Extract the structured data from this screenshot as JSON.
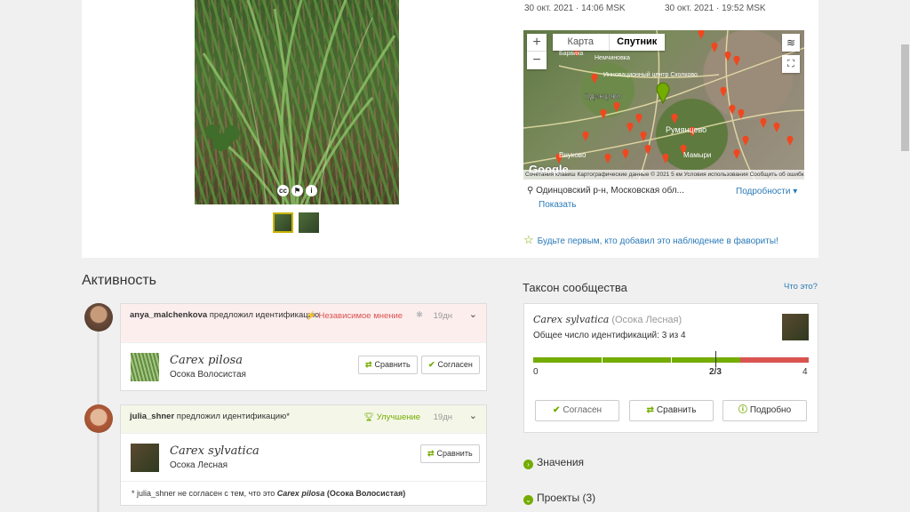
{
  "dates": {
    "observed": "30 окт. 2021 · 14:06 MSK",
    "submitted": "30 окт. 2021 · 19:52 MSK"
  },
  "photo": {
    "icons": [
      "cc-icon",
      "flag-icon",
      "info-icon"
    ],
    "thumb_count": 2
  },
  "map": {
    "zoom_in": "+",
    "zoom_out": "−",
    "type_map": "Карта",
    "type_satellite": "Спутник",
    "labels": [
      "Одинцово",
      "Инновационный центр Сколково",
      "Немчиновка",
      "Барвиха",
      "Румянцево",
      "Внуково",
      "Мамыри"
    ],
    "attribution": "Сочетания клавиш   Картографические данные © 2021   5 км        Условия использования   Сообщить об ошибке на карте",
    "google": "Google"
  },
  "place": {
    "name": "Одинцовский р-н, Московская обл...",
    "details": "Подробности ▾",
    "show": "Показать"
  },
  "favorite": "Будьте первым, кто добавил это наблюдение в фавориты!",
  "activity": {
    "title": "Активность",
    "items": [
      {
        "user": "anya_malchenkova",
        "action": " предложил идентификацию",
        "tag": "Независимое мнение",
        "ago": "19дн",
        "sci": "Carex pilosa",
        "common": "Осока Волосистая",
        "compare": "Сравнить",
        "agree": "Согласен"
      },
      {
        "user": "julia_shner",
        "action": " предложил идентификацию*",
        "tag": "Улучшение",
        "ago": "19дн",
        "sci": "Carex sylvatica",
        "common": "Осока Лесная",
        "compare": "Сравнить",
        "disagree_prefix": "* julia_shner не согласен с тем, что это ",
        "disagree_taxon": "Carex pilosa",
        "disagree_common": " (Осока Волосистая)"
      }
    ]
  },
  "community": {
    "title": "Таксон сообщества",
    "what": "Что это?",
    "sci": "Carex sylvatica",
    "common": "(Осока Лесная)",
    "count_text": "Общее число идентификаций: 3 из 4",
    "scale_min": "0",
    "scale_mid": "2/3",
    "scale_max": "4",
    "agree_fraction": 0.75,
    "agree": "Согласен",
    "compare": "Сравнить",
    "about": "Подробно"
  },
  "sections": {
    "values": "Значения",
    "projects": "Проекты (3)"
  },
  "colors": {
    "accent": "#74ac00",
    "link": "#2a7ab8",
    "danger": "#d9534f"
  }
}
